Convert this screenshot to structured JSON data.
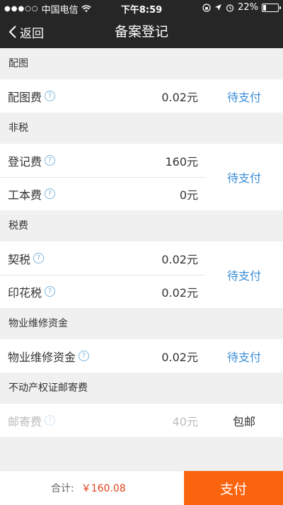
{
  "status_bar": {
    "carrier": "中国电信",
    "time": "下午8:59",
    "battery": "22%",
    "battery_level": 0.22
  },
  "nav": {
    "back_label": "返回",
    "title": "备案登记"
  },
  "sections": [
    {
      "header": "配图",
      "status": "待支付",
      "items": [
        {
          "label": "配图费",
          "amount": "0.02元"
        }
      ]
    },
    {
      "header": "非税",
      "status": "待支付",
      "items": [
        {
          "label": "登记费",
          "amount": "160元"
        },
        {
          "label": "工本费",
          "amount": "0元"
        }
      ]
    },
    {
      "header": "税费",
      "status": "待支付",
      "items": [
        {
          "label": "契税",
          "amount": "0.02元"
        },
        {
          "label": "印花税",
          "amount": "0.02元"
        }
      ]
    },
    {
      "header": "物业维修资金",
      "status": "待支付",
      "items": [
        {
          "label": "物业维修资金",
          "amount": "0.02元"
        }
      ]
    },
    {
      "header": "不动产权证邮寄费",
      "status": "包邮",
      "items": [
        {
          "label": "邮寄费",
          "amount": "40元"
        }
      ]
    }
  ],
  "footer": {
    "total_label": "合计:",
    "total_amount": "￥160.08",
    "pay_label": "支付"
  },
  "colors": {
    "accent_blue": "#3b8ed6",
    "pay_orange": "#fb640f",
    "total_red": "#e2421a",
    "nav_bg": "#262626"
  }
}
